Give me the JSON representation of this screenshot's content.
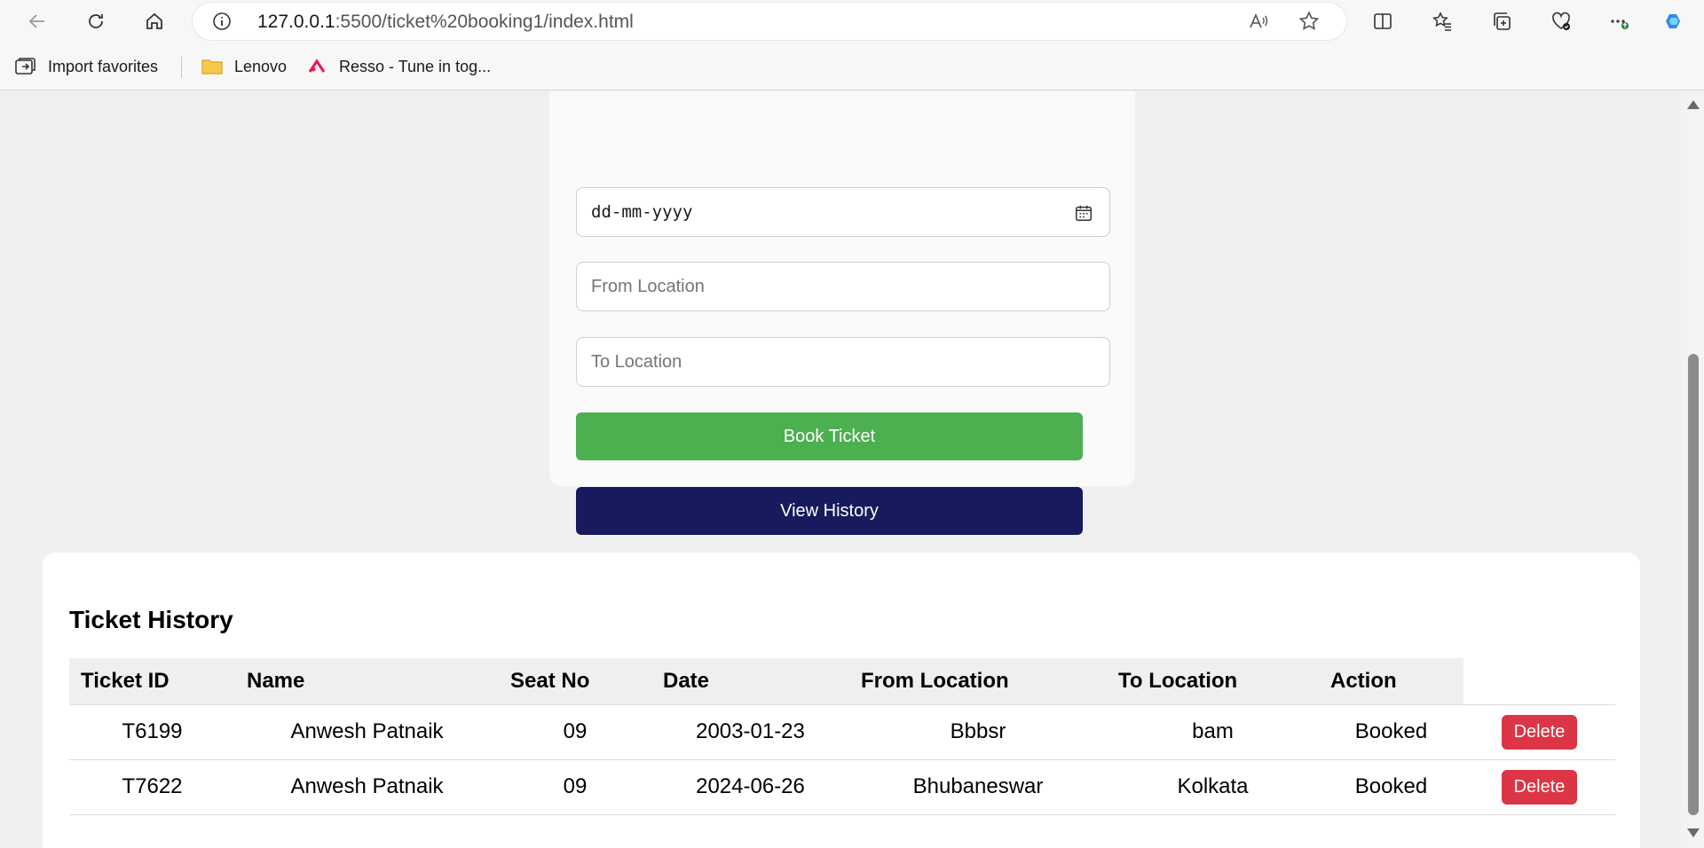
{
  "browser": {
    "url_host": "127.0.0.1",
    "url_rest": ":5500/ticket%20booking1/index.html",
    "bookmarks": [
      {
        "label": "Import favorites",
        "icon": "import-icon"
      },
      {
        "label": "Lenovo",
        "icon": "folder-icon"
      },
      {
        "label": "Resso - Tune in tog...",
        "icon": "resso-icon"
      }
    ]
  },
  "form": {
    "date_placeholder": "dd-mm-yyyy",
    "from_placeholder": "From Location",
    "to_placeholder": "To Location",
    "book_label": "Book Ticket",
    "history_label": "View History",
    "colors": {
      "book": "#4caf50",
      "history": "#171a5c"
    }
  },
  "history": {
    "title": "Ticket History",
    "columns": [
      "Ticket ID",
      "Name",
      "Seat No",
      "Date",
      "From Location",
      "To Location",
      "Action"
    ],
    "rows": [
      {
        "id": "T6199",
        "name": "Anwesh Patnaik",
        "seat": "09",
        "date": "2003-01-23",
        "from": "Bbbsr",
        "to": "bam",
        "status": "Booked",
        "action": "Delete"
      },
      {
        "id": "T7622",
        "name": "Anwesh Patnaik",
        "seat": "09",
        "date": "2024-06-26",
        "from": "Bhubaneswar",
        "to": "Kolkata",
        "status": "Booked",
        "action": "Delete"
      }
    ],
    "delete_color": "#dc3545"
  }
}
